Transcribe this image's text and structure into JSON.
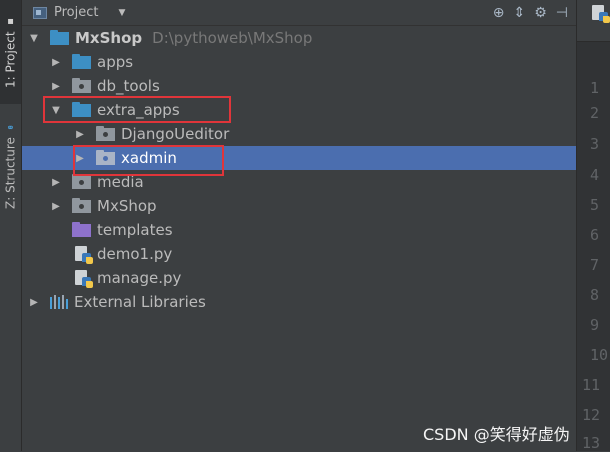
{
  "sidebar": {
    "project_tab": "1: Project",
    "structure_tab": "Z: Structure"
  },
  "header": {
    "title": "Project"
  },
  "tree": {
    "root_name": "MxShop",
    "root_path": "D:\\pythoweb\\MxShop",
    "items": [
      {
        "label": "apps"
      },
      {
        "label": "db_tools"
      },
      {
        "label": "extra_apps"
      },
      {
        "label": "DjangoUeditor"
      },
      {
        "label": "xadmin"
      },
      {
        "label": "media"
      },
      {
        "label": "MxShop"
      },
      {
        "label": "templates"
      },
      {
        "label": "demo1.py"
      },
      {
        "label": "manage.py"
      },
      {
        "label": "External Libraries"
      }
    ]
  },
  "editor": {
    "line_numbers": [
      "1",
      "2",
      "3",
      "4",
      "5",
      "6",
      "7",
      "8",
      "9",
      "10",
      "11",
      "12",
      "13"
    ]
  },
  "watermark": "CSDN @笑得好虚伪",
  "colors": {
    "background": "#3c3f41",
    "selection": "#4b6eaf",
    "highlight_box": "#e0353a"
  }
}
